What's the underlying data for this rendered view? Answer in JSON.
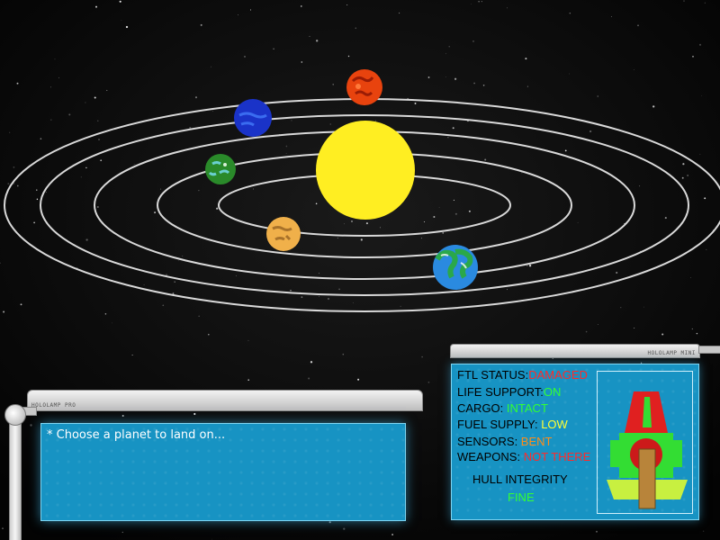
{
  "dialog": {
    "brand": "HOLOLAMP PRO",
    "prompt": "* Choose a planet to land on..."
  },
  "status_panel": {
    "brand": "HOLOLAMP MINI",
    "rows": [
      {
        "label": "FTL STATUS:",
        "value": "DAMAGED",
        "color": "#ff2a2a"
      },
      {
        "label": "LIFE SUPPORT:",
        "value": "ON",
        "color": "#33ff33"
      },
      {
        "label": "CARGO: ",
        "value": "INTACT",
        "color": "#33ff33"
      },
      {
        "label": "FUEL SUPPLY: ",
        "value": "LOW",
        "color": "#ffff33"
      },
      {
        "label": "SENSORS: ",
        "value": "BENT",
        "color": "#ff8c1a"
      },
      {
        "label": "WEAPONS: ",
        "value": "NOT THERE",
        "color": "#ff2a2a"
      }
    ],
    "hull_label": "HULL INTEGRITY",
    "hull_value": "FINE",
    "hull_color": "#33ff33"
  },
  "planets": [
    {
      "name": "red-planet",
      "color": "#e8430e"
    },
    {
      "name": "blue-planet",
      "color": "#1a33c8"
    },
    {
      "name": "green-planet",
      "color": "#2a8a2a"
    },
    {
      "name": "desert-planet",
      "color": "#f0b04a"
    },
    {
      "name": "earth-planet",
      "color": "#2a8ae0"
    }
  ],
  "sun_color": "#ffee22"
}
